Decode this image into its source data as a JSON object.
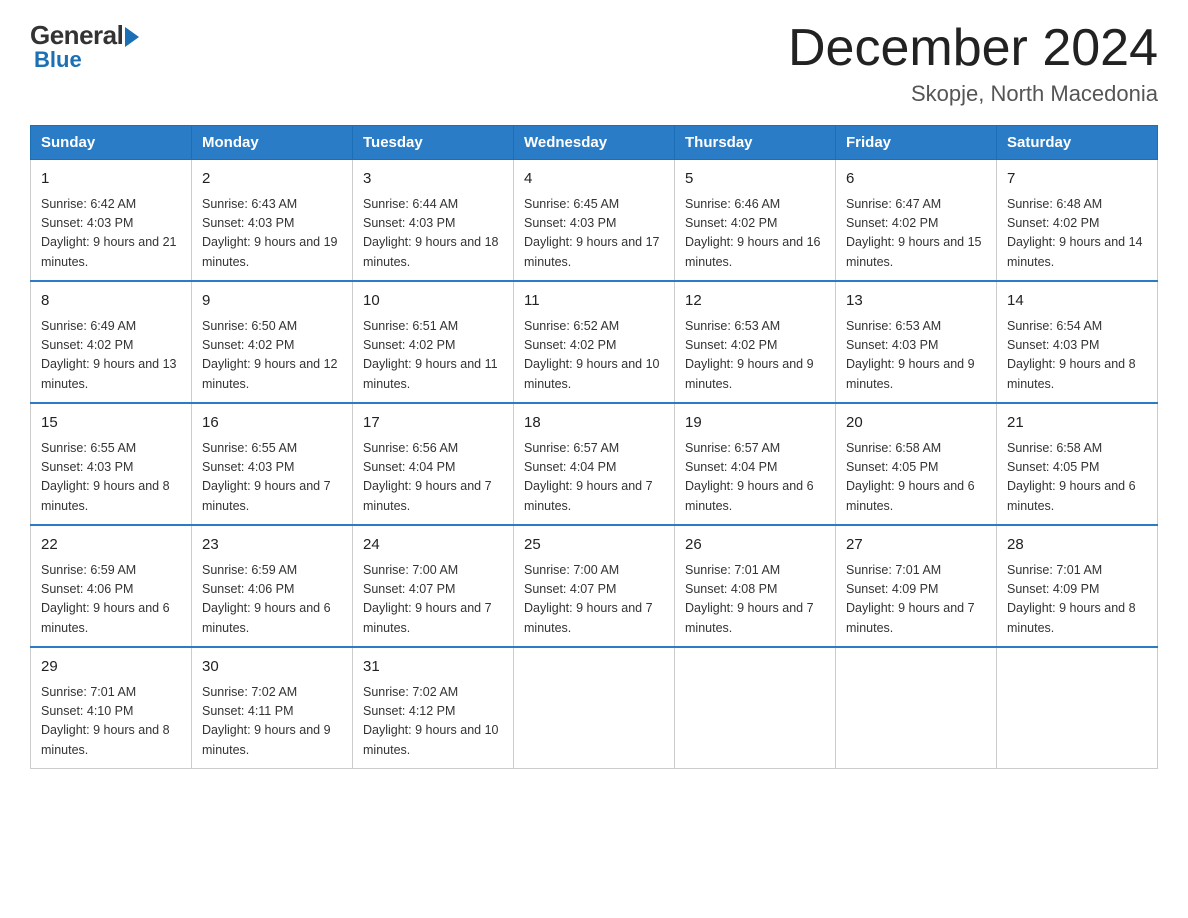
{
  "logo": {
    "general": "General",
    "blue": "Blue"
  },
  "header": {
    "month_title": "December 2024",
    "location": "Skopje, North Macedonia"
  },
  "days_of_week": [
    "Sunday",
    "Monday",
    "Tuesday",
    "Wednesday",
    "Thursday",
    "Friday",
    "Saturday"
  ],
  "weeks": [
    [
      {
        "day": "1",
        "sunrise": "Sunrise: 6:42 AM",
        "sunset": "Sunset: 4:03 PM",
        "daylight": "Daylight: 9 hours and 21 minutes."
      },
      {
        "day": "2",
        "sunrise": "Sunrise: 6:43 AM",
        "sunset": "Sunset: 4:03 PM",
        "daylight": "Daylight: 9 hours and 19 minutes."
      },
      {
        "day": "3",
        "sunrise": "Sunrise: 6:44 AM",
        "sunset": "Sunset: 4:03 PM",
        "daylight": "Daylight: 9 hours and 18 minutes."
      },
      {
        "day": "4",
        "sunrise": "Sunrise: 6:45 AM",
        "sunset": "Sunset: 4:03 PM",
        "daylight": "Daylight: 9 hours and 17 minutes."
      },
      {
        "day": "5",
        "sunrise": "Sunrise: 6:46 AM",
        "sunset": "Sunset: 4:02 PM",
        "daylight": "Daylight: 9 hours and 16 minutes."
      },
      {
        "day": "6",
        "sunrise": "Sunrise: 6:47 AM",
        "sunset": "Sunset: 4:02 PM",
        "daylight": "Daylight: 9 hours and 15 minutes."
      },
      {
        "day": "7",
        "sunrise": "Sunrise: 6:48 AM",
        "sunset": "Sunset: 4:02 PM",
        "daylight": "Daylight: 9 hours and 14 minutes."
      }
    ],
    [
      {
        "day": "8",
        "sunrise": "Sunrise: 6:49 AM",
        "sunset": "Sunset: 4:02 PM",
        "daylight": "Daylight: 9 hours and 13 minutes."
      },
      {
        "day": "9",
        "sunrise": "Sunrise: 6:50 AM",
        "sunset": "Sunset: 4:02 PM",
        "daylight": "Daylight: 9 hours and 12 minutes."
      },
      {
        "day": "10",
        "sunrise": "Sunrise: 6:51 AM",
        "sunset": "Sunset: 4:02 PM",
        "daylight": "Daylight: 9 hours and 11 minutes."
      },
      {
        "day": "11",
        "sunrise": "Sunrise: 6:52 AM",
        "sunset": "Sunset: 4:02 PM",
        "daylight": "Daylight: 9 hours and 10 minutes."
      },
      {
        "day": "12",
        "sunrise": "Sunrise: 6:53 AM",
        "sunset": "Sunset: 4:02 PM",
        "daylight": "Daylight: 9 hours and 9 minutes."
      },
      {
        "day": "13",
        "sunrise": "Sunrise: 6:53 AM",
        "sunset": "Sunset: 4:03 PM",
        "daylight": "Daylight: 9 hours and 9 minutes."
      },
      {
        "day": "14",
        "sunrise": "Sunrise: 6:54 AM",
        "sunset": "Sunset: 4:03 PM",
        "daylight": "Daylight: 9 hours and 8 minutes."
      }
    ],
    [
      {
        "day": "15",
        "sunrise": "Sunrise: 6:55 AM",
        "sunset": "Sunset: 4:03 PM",
        "daylight": "Daylight: 9 hours and 8 minutes."
      },
      {
        "day": "16",
        "sunrise": "Sunrise: 6:55 AM",
        "sunset": "Sunset: 4:03 PM",
        "daylight": "Daylight: 9 hours and 7 minutes."
      },
      {
        "day": "17",
        "sunrise": "Sunrise: 6:56 AM",
        "sunset": "Sunset: 4:04 PM",
        "daylight": "Daylight: 9 hours and 7 minutes."
      },
      {
        "day": "18",
        "sunrise": "Sunrise: 6:57 AM",
        "sunset": "Sunset: 4:04 PM",
        "daylight": "Daylight: 9 hours and 7 minutes."
      },
      {
        "day": "19",
        "sunrise": "Sunrise: 6:57 AM",
        "sunset": "Sunset: 4:04 PM",
        "daylight": "Daylight: 9 hours and 6 minutes."
      },
      {
        "day": "20",
        "sunrise": "Sunrise: 6:58 AM",
        "sunset": "Sunset: 4:05 PM",
        "daylight": "Daylight: 9 hours and 6 minutes."
      },
      {
        "day": "21",
        "sunrise": "Sunrise: 6:58 AM",
        "sunset": "Sunset: 4:05 PM",
        "daylight": "Daylight: 9 hours and 6 minutes."
      }
    ],
    [
      {
        "day": "22",
        "sunrise": "Sunrise: 6:59 AM",
        "sunset": "Sunset: 4:06 PM",
        "daylight": "Daylight: 9 hours and 6 minutes."
      },
      {
        "day": "23",
        "sunrise": "Sunrise: 6:59 AM",
        "sunset": "Sunset: 4:06 PM",
        "daylight": "Daylight: 9 hours and 6 minutes."
      },
      {
        "day": "24",
        "sunrise": "Sunrise: 7:00 AM",
        "sunset": "Sunset: 4:07 PM",
        "daylight": "Daylight: 9 hours and 7 minutes."
      },
      {
        "day": "25",
        "sunrise": "Sunrise: 7:00 AM",
        "sunset": "Sunset: 4:07 PM",
        "daylight": "Daylight: 9 hours and 7 minutes."
      },
      {
        "day": "26",
        "sunrise": "Sunrise: 7:01 AM",
        "sunset": "Sunset: 4:08 PM",
        "daylight": "Daylight: 9 hours and 7 minutes."
      },
      {
        "day": "27",
        "sunrise": "Sunrise: 7:01 AM",
        "sunset": "Sunset: 4:09 PM",
        "daylight": "Daylight: 9 hours and 7 minutes."
      },
      {
        "day": "28",
        "sunrise": "Sunrise: 7:01 AM",
        "sunset": "Sunset: 4:09 PM",
        "daylight": "Daylight: 9 hours and 8 minutes."
      }
    ],
    [
      {
        "day": "29",
        "sunrise": "Sunrise: 7:01 AM",
        "sunset": "Sunset: 4:10 PM",
        "daylight": "Daylight: 9 hours and 8 minutes."
      },
      {
        "day": "30",
        "sunrise": "Sunrise: 7:02 AM",
        "sunset": "Sunset: 4:11 PM",
        "daylight": "Daylight: 9 hours and 9 minutes."
      },
      {
        "day": "31",
        "sunrise": "Sunrise: 7:02 AM",
        "sunset": "Sunset: 4:12 PM",
        "daylight": "Daylight: 9 hours and 10 minutes."
      },
      null,
      null,
      null,
      null
    ]
  ]
}
